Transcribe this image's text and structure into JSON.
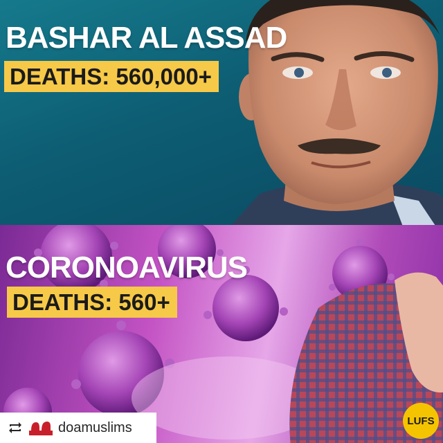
{
  "top": {
    "headline": "BASHAR AL ASSAD",
    "deaths": "DEATHS: 560,000+"
  },
  "bottom": {
    "headline": "CORONOAVIRUS",
    "deaths": "DEATHS: 560+"
  },
  "repost": {
    "icon": "repost-icon",
    "source": "doamuslims"
  },
  "badge": {
    "text": "LUFS"
  },
  "colors": {
    "highlight": "#f7c948",
    "teal": "#0d5d73",
    "magenta": "#c453c4",
    "badge": "#f5c400"
  }
}
